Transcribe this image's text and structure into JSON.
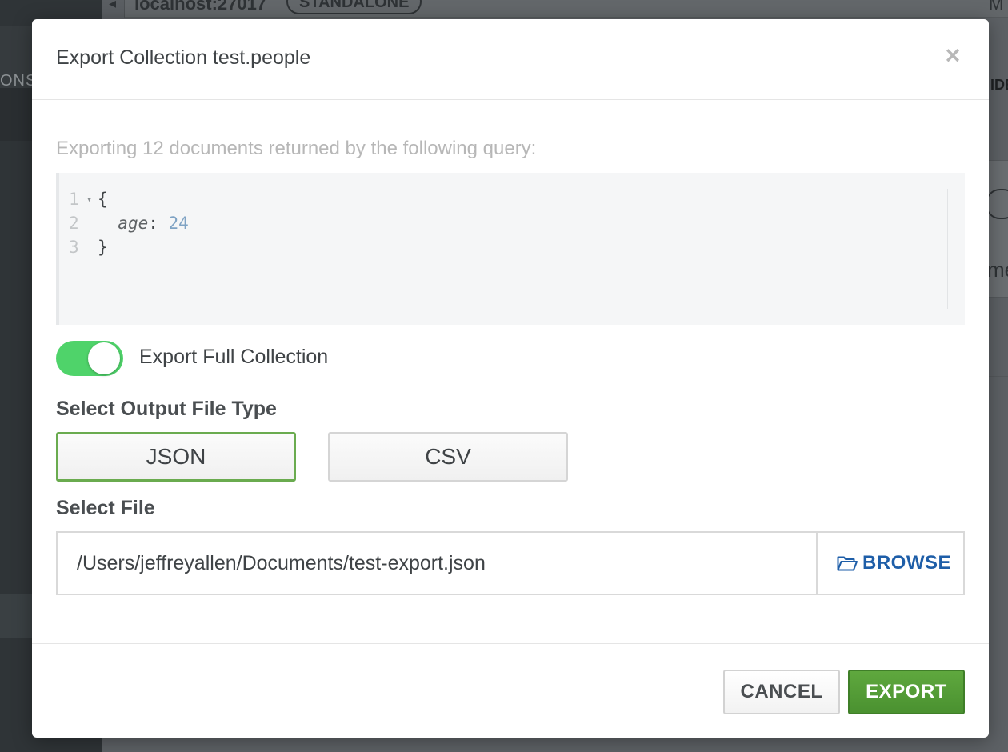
{
  "background": {
    "sidebar_cut_text": "ONS",
    "host_text": "localhost:27017",
    "instance_badge": "STANDALONE",
    "right_edge_top": "M",
    "right_edge_header": "IDE",
    "right_edge_text": "me"
  },
  "modal": {
    "title": "Export Collection test.people",
    "close_glyph": "×"
  },
  "query": {
    "caption": "Exporting 12 documents returned by the following query:",
    "lines": [
      {
        "number": "1",
        "fold": "▾",
        "open_brace": "{"
      },
      {
        "number": "2",
        "key": "age",
        "colon": ": ",
        "value": "24"
      },
      {
        "number": "3",
        "close_brace": "}"
      }
    ]
  },
  "full_collection_toggle": {
    "label": "Export Full Collection",
    "state": "on",
    "color": "#4fd36a"
  },
  "file_type": {
    "title": "Select Output File Type",
    "options": [
      "JSON",
      "CSV"
    ],
    "selected": "JSON",
    "selected_border_color": "#6aab4f"
  },
  "select_file": {
    "title": "Select File",
    "path": "/Users/jeffreyallen/Documents/test-export.json",
    "browse_icon": "folder-open-icon",
    "browse_label": "BROWSE"
  },
  "footer": {
    "cancel_label": "CANCEL",
    "export_label": "EXPORT",
    "export_color": "#5fa83e"
  }
}
